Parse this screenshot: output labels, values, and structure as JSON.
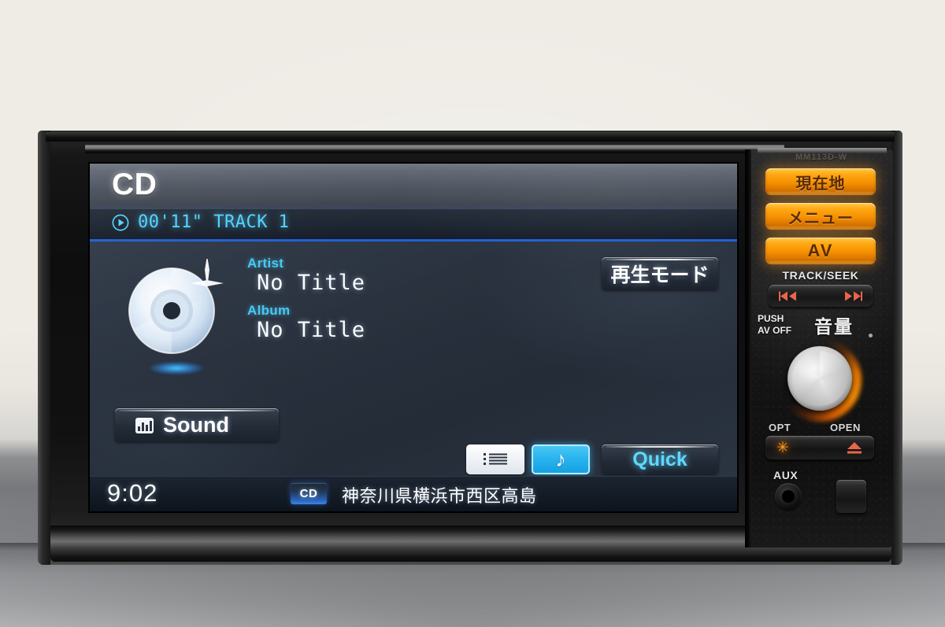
{
  "device": {
    "model_label": "MM113D-W",
    "type": "car-navigation-head-unit"
  },
  "screen": {
    "header": {
      "title": "CD",
      "play_icon": "play-circle-icon",
      "track_info": "00'11\"  TRACK 1"
    },
    "now_playing": {
      "disc_icon": "compact-disc-icon",
      "artist_label": "Artist",
      "artist_value": "No Title",
      "album_label": "Album",
      "album_value": "No Title"
    },
    "buttons": {
      "play_mode": "再生モード",
      "sound": "Sound",
      "sound_icon": "equalizer-icon",
      "list_icon": "list-icon",
      "music_icon": "music-note-icon",
      "quick": "Quick"
    },
    "status_bar": {
      "clock": "9:02",
      "source_badge": "CD",
      "address": "神奈川県横浜市西区高島"
    }
  },
  "controls": {
    "amber_buttons": [
      {
        "label": "現在地",
        "name": "current-location"
      },
      {
        "label": "メニュー",
        "name": "menu"
      },
      {
        "label": "AV",
        "name": "av"
      }
    ],
    "track_seek_label": "TRACK/SEEK",
    "seek_prev_icon": "skip-previous-icon",
    "seek_next_icon": "skip-next-icon",
    "volume_label": "音量",
    "push_av_off_line1": "PUSH",
    "push_av_off_line2": "AV OFF",
    "opt_label": "OPT",
    "opt_icon": "asterisk-icon",
    "open_label": "OPEN",
    "open_icon": "eject-icon",
    "aux_label": "AUX",
    "aux_icon": "aux-jack-icon"
  },
  "colors": {
    "amber": "#ffa913",
    "cyan_text": "#4fd3ff",
    "accent_blue": "#1d5fd6",
    "screen_bg": "#2a3342"
  }
}
